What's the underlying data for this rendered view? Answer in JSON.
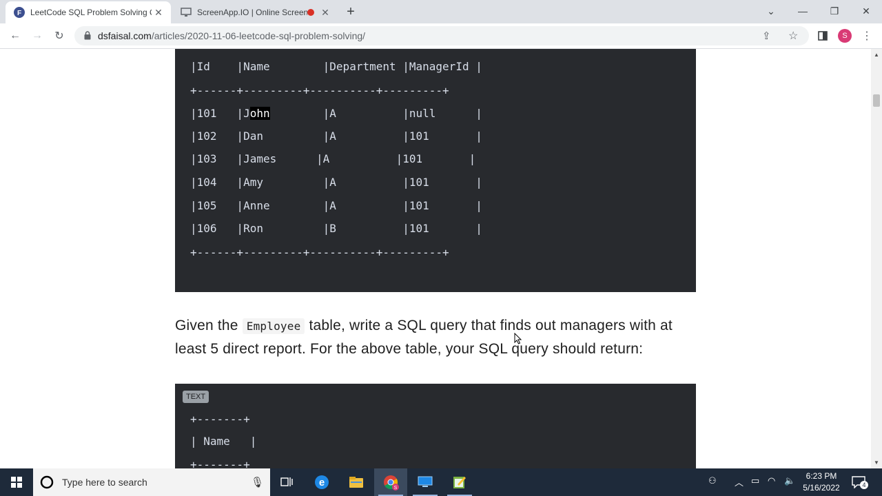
{
  "browser": {
    "tabs": [
      {
        "title": "LeetCode SQL Problem Solving Q",
        "favicon": "F",
        "active": true
      },
      {
        "title": "ScreenApp.IO | Online Screen",
        "favicon": "monitor-icon",
        "recording": true,
        "active": false
      }
    ],
    "url_domain": "dsfaisal.com",
    "url_path": "/articles/2020-11-06-leetcode-sql-problem-solving/",
    "avatar_letter": "S",
    "accent_color": "#5b2a86"
  },
  "page": {
    "code1_lines": [
      "+------+---------+----------+---------+",
      "|Id    |Name        |Department |ManagerId |",
      "+------+---------+----------+---------+",
      "|101   |J",
      "|102   |Dan         |A          |101       |",
      "|103   |James      |A          |101       |",
      "|104   |Amy         |A          |101       |",
      "|105   |Anne        |A          |101       |",
      "|106   |Ron         |B          |101       |",
      "+------+---------+----------+---------+"
    ],
    "code1_row101_highlight": "ohn",
    "code1_row101_rest": "        |A          |null      |",
    "paragraph_before": "Given the ",
    "paragraph_code": "Employee",
    "paragraph_after": " table, write a SQL query that finds out managers with at least 5 direct report. For the above table, your SQL query should return:",
    "code2_badge": "TEXT",
    "code2_lines": [
      "+-------+",
      "| Name   |",
      "+-------+"
    ]
  },
  "taskbar": {
    "search_placeholder": "Type here to search",
    "time": "6:23 PM",
    "date": "5/16/2022",
    "notification_count": "4",
    "chrome_badge": "S"
  }
}
